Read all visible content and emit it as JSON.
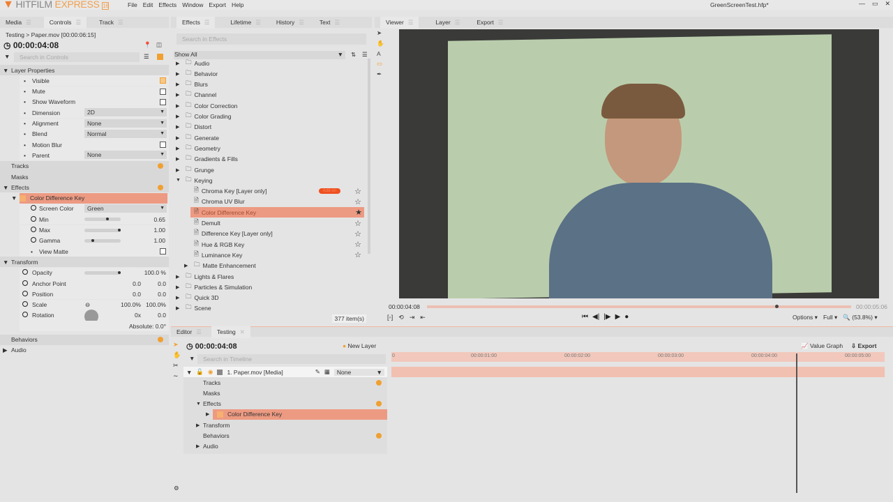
{
  "app": {
    "logo_text": "HITFILM",
    "logo_accent": "EXPRESS",
    "version": "16",
    "title": "GreenScreenTest.hfp*",
    "menu": [
      "File",
      "Edit",
      "Effects",
      "Window",
      "Export",
      "Help"
    ]
  },
  "colors": {
    "accent": "#f0a030",
    "selection": "#ed9a82",
    "badge": "#f05020"
  },
  "left": {
    "tabs": [
      "Media",
      "Controls",
      "Track"
    ],
    "breadcrumb": "Testing  > Paper.mov [00:00:06:15]",
    "timecode": "00:00:04:08",
    "search_placeholder": "Search in Controls",
    "layer_props_label": "Layer Properties",
    "props": [
      {
        "label": "Visible",
        "type": "check",
        "checked": true
      },
      {
        "label": "Mute",
        "type": "check"
      },
      {
        "label": "Show Waveform",
        "type": "check"
      },
      {
        "label": "Dimension",
        "type": "dd",
        "value": "2D"
      },
      {
        "label": "Alignment",
        "type": "dd",
        "value": "None"
      },
      {
        "label": "Blend",
        "type": "dd",
        "value": "Normal"
      },
      {
        "label": "Motion Blur",
        "type": "check"
      },
      {
        "label": "Parent",
        "type": "dd",
        "value": "None"
      }
    ],
    "tracks": "Tracks",
    "masks": "Masks",
    "effects": "Effects",
    "effect_name": "Color Difference Key",
    "effect_props": [
      {
        "label": "Screen Color",
        "type": "dd",
        "value": "Green"
      },
      {
        "label": "Min",
        "type": "slider",
        "value": "0.65",
        "pos": 0.65
      },
      {
        "label": "Max",
        "type": "slider",
        "value": "1.00",
        "pos": 1.0
      },
      {
        "label": "Gamma",
        "type": "slider",
        "value": "1.00",
        "pos": 0.2
      },
      {
        "label": "View Matte",
        "type": "check"
      }
    ],
    "transform": "Transform",
    "transform_props": [
      {
        "label": "Opacity",
        "v1": "100.0 %",
        "slider": 1.0
      },
      {
        "label": "Anchor Point",
        "v0": "0.0",
        "v1": "0.0"
      },
      {
        "label": "Position",
        "v0": "0.0",
        "v1": "0.0"
      },
      {
        "label": "Scale",
        "v0": "100.0%",
        "v1": "100.0%"
      },
      {
        "label": "Rotation",
        "v0": "0x",
        "v1": "0.0"
      }
    ],
    "absolute": "Absolute: 0.0°",
    "behaviors": "Behaviors",
    "audio": "Audio"
  },
  "effects": {
    "tabs": [
      "Effects",
      "Lifetime",
      "History",
      "Text"
    ],
    "search_placeholder": "Search in Effects",
    "filter": "Show All",
    "count": "377 item(s)",
    "badge": "Add-on",
    "items": [
      {
        "l": "Audio",
        "d": 0,
        "f": 1
      },
      {
        "l": "Behavior",
        "d": 0,
        "f": 1
      },
      {
        "l": "Blurs",
        "d": 0,
        "f": 1
      },
      {
        "l": "Channel",
        "d": 0,
        "f": 1
      },
      {
        "l": "Color Correction",
        "d": 0,
        "f": 1
      },
      {
        "l": "Color Grading",
        "d": 0,
        "f": 1
      },
      {
        "l": "Distort",
        "d": 0,
        "f": 1
      },
      {
        "l": "Generate",
        "d": 0,
        "f": 1
      },
      {
        "l": "Geometry",
        "d": 0,
        "f": 1
      },
      {
        "l": "Gradients & Fills",
        "d": 0,
        "f": 1
      },
      {
        "l": "Grunge",
        "d": 0,
        "f": 1
      },
      {
        "l": "Keying",
        "d": 0,
        "f": 1,
        "open": 1
      },
      {
        "l": "Chroma Key [Layer only]",
        "d": 1,
        "star": 1,
        "badge": 1
      },
      {
        "l": "Chroma UV Blur",
        "d": 1,
        "star": 1
      },
      {
        "l": "Color Difference Key",
        "d": 1,
        "star": 2,
        "sel": 1
      },
      {
        "l": "Demult",
        "d": 1,
        "star": 1
      },
      {
        "l": "Difference Key [Layer only]",
        "d": 1,
        "star": 1
      },
      {
        "l": "Hue & RGB Key",
        "d": 1,
        "star": 1
      },
      {
        "l": "Luminance Key",
        "d": 1,
        "star": 1
      },
      {
        "l": "Matte Enhancement",
        "d": 1,
        "f": 1
      },
      {
        "l": "Lights & Flares",
        "d": 0,
        "f": 1
      },
      {
        "l": "Particles & Simulation",
        "d": 0,
        "f": 1
      },
      {
        "l": "Quick 3D",
        "d": 0,
        "f": 1
      },
      {
        "l": "Scene",
        "d": 0,
        "f": 1
      }
    ]
  },
  "viewer": {
    "tabs": [
      "Viewer",
      "Layer",
      "Export"
    ],
    "current": "00:00:04:08",
    "end": "00:00:05:06",
    "playhead": 0.82,
    "options": "Options",
    "quality": "Full",
    "zoom": "(53.8%)"
  },
  "editor": {
    "tabs": [
      "Editor",
      "Testing"
    ],
    "timecode": "00:00:04:08",
    "new_layer": "New Layer",
    "search_placeholder": "Search in Timeline",
    "value_graph": "Value Graph",
    "export": "Export",
    "layer": "1. Paper.mov [Media]",
    "blend": "None",
    "tree": [
      {
        "l": "Tracks",
        "i": 0,
        "plus": 1
      },
      {
        "l": "Masks",
        "i": 0
      },
      {
        "l": "Effects",
        "i": 0,
        "open": 1,
        "plus": 1
      },
      {
        "l": "Color Difference Key",
        "i": 1,
        "sel": 1
      },
      {
        "l": "Transform",
        "i": 0,
        "closed": 1
      },
      {
        "l": "Behaviors",
        "i": 0,
        "plus": 1
      },
      {
        "l": "Audio",
        "i": 0,
        "closed": 1
      }
    ],
    "ruler": [
      "0",
      "00:00:01:00",
      "00:00:02:00",
      "00:00:03:00",
      "00:00:04:00",
      "00:00:05:00"
    ],
    "playhead": 0.82
  }
}
